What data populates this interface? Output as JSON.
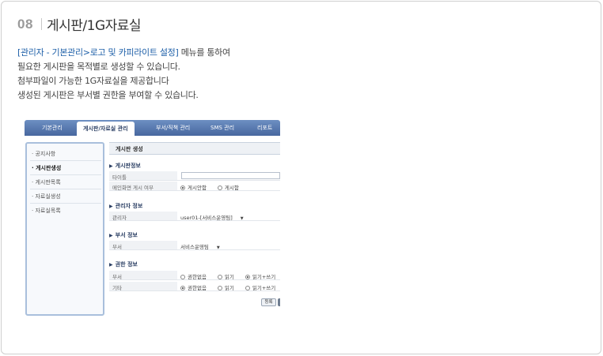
{
  "section": {
    "number": "08",
    "title": "게시판/1G자료실"
  },
  "description": {
    "line1_accent": "[관리자 - 기본관리>로고 및 카피라이트 설정]",
    "line1_rest": " 메뉴를 통하여",
    "line2": "필요한 게시판을 목적별로 생성할 수 있습니다.",
    "line3": "첨부파일이 가능한 1G자료실을 제공합니다",
    "line4": "생성된 게시판은 부서별 권한을 부여할 수 있습니다."
  },
  "admin": {
    "topnav": [
      "기본관리",
      "게시판/자료실 관리",
      "부서/직책 관리",
      "SMS 관리",
      "리포트"
    ],
    "topnav_active": "게시판/자료실 관리",
    "leftnav": [
      "· 공지사항",
      "· 게시판생성",
      "· 게시판목록",
      "· 자료실생성",
      "· 자료실목록"
    ],
    "leftnav_active": "· 게시판생성",
    "panel_title": "게시판 생성",
    "board_info": {
      "title": "게시판정보",
      "row1_label": "타이틀",
      "row1_value": "",
      "row2_label": "메인화면 게시 여부",
      "row2_opt1": "게시안함",
      "row2_opt2": "게시함"
    },
    "manager_info": {
      "title": "관리자 정보",
      "label": "관리자",
      "value": "user01-[서비스운영팀]"
    },
    "dept_info": {
      "title": "부서 정보",
      "label": "부서",
      "value": "서비스운영팀"
    },
    "perm_info": {
      "title": "권한 정보",
      "row1_label": "부서",
      "row2_label": "기타",
      "opt_none": "권한없음",
      "opt_read": "읽기",
      "opt_rw": "읽기+쓰기"
    },
    "submit_label": "등록"
  }
}
